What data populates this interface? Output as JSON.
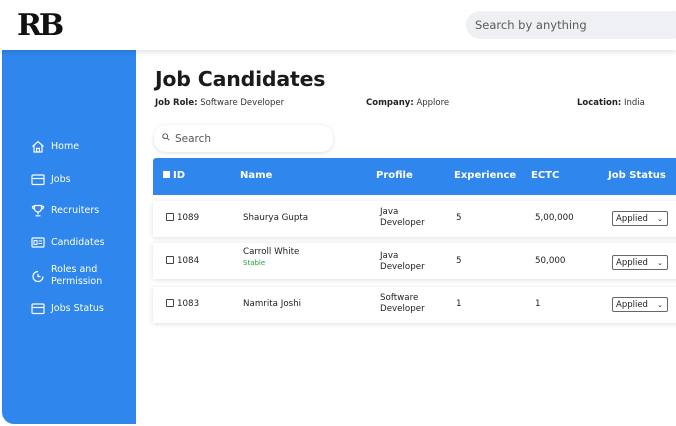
{
  "header": {
    "logo_text": "RB",
    "search_placeholder": "Search by anything"
  },
  "sidebar": {
    "items": [
      {
        "label": "Home",
        "icon": "home-icon"
      },
      {
        "label": "Jobs",
        "icon": "briefcase-icon"
      },
      {
        "label": "Recruiters",
        "icon": "trophy-icon"
      },
      {
        "label": "Candidates",
        "icon": "id-card-icon"
      },
      {
        "label": "Roles and Permission",
        "icon": "clock-icon"
      },
      {
        "label": "Jobs Status",
        "icon": "briefcase-icon"
      }
    ]
  },
  "main": {
    "title": "Job Candidates",
    "job_role_label": "Job Role:",
    "job_role_value": "Software Developer",
    "company_label": "Company:",
    "company_value": "Applore",
    "location_label": "Location:",
    "location_value": "India",
    "search_placeholder": "Search"
  },
  "table": {
    "columns": [
      "ID",
      "Name",
      "Profile",
      "Experience",
      "ECTC",
      "Job Status"
    ],
    "rows": [
      {
        "id": "1089",
        "name": "Shaurya Gupta",
        "name_sub": "",
        "profile_line1": "Java",
        "profile_line2": "Developer",
        "experience": "5",
        "ectc": "5,00,000",
        "status": "Applied"
      },
      {
        "id": "1084",
        "name": "Carroll White",
        "name_sub": "Stable",
        "profile_line1": "Java",
        "profile_line2": "Developer",
        "experience": "5",
        "ectc": "50,000",
        "status": "Applied"
      },
      {
        "id": "1083",
        "name": "Namrita Joshi",
        "name_sub": "",
        "profile_line1": "Software",
        "profile_line2": "Developer",
        "experience": "1",
        "ectc": "1",
        "status": "Applied"
      }
    ]
  },
  "colors": {
    "accent": "#2f86ec",
    "stable": "#22a53a"
  }
}
